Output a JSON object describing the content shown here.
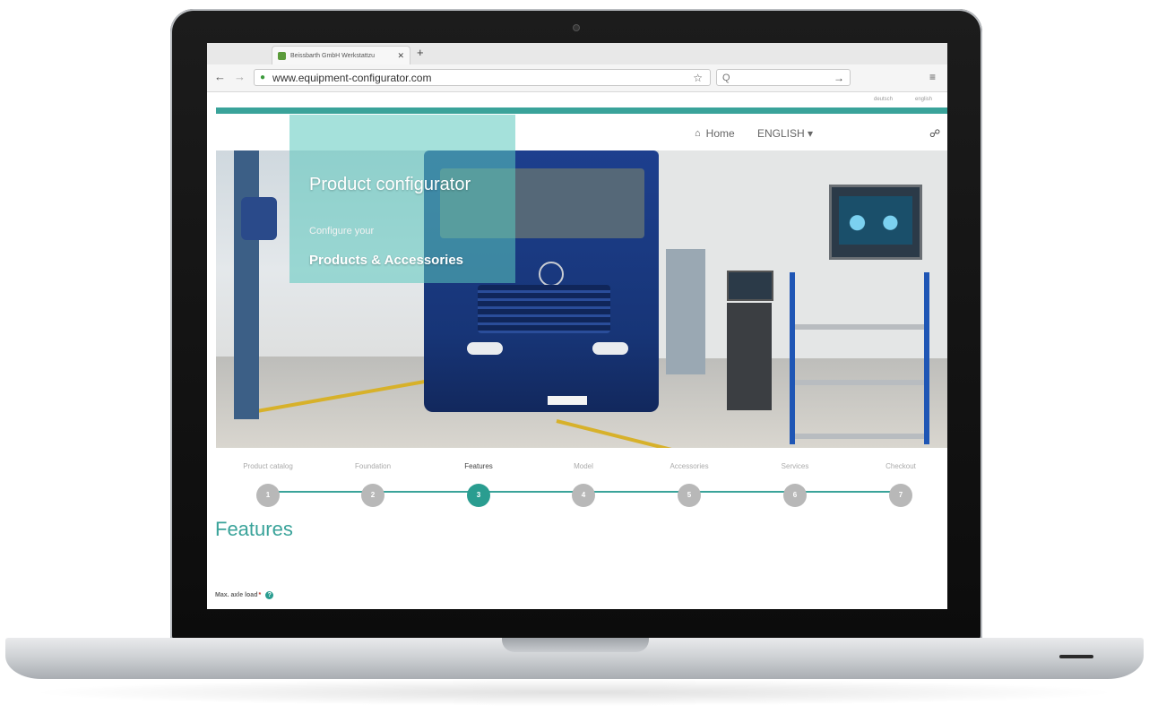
{
  "browser": {
    "tab_title": "Beissbarth GmbH Werkstattzu",
    "tab_close": "✕",
    "new_tab": "+",
    "back": "←",
    "forward": "→",
    "url": "www.equipment-configurator.com",
    "search_placeholder": "Q",
    "search_go": "→",
    "menu": "≡",
    "bookmark": "☆",
    "lock": "🔒"
  },
  "header": {
    "lang_links": [
      "deutsch",
      "english"
    ],
    "home_label": "Home",
    "language_label": "ENGLISH ▾",
    "cart_icon": "🛒"
  },
  "hero": {
    "title": "Product configurator",
    "subtitle1": "Configure your",
    "subtitle2": "Products & Accessories"
  },
  "stepper": {
    "active_step": 3,
    "steps": [
      {
        "label": "Product catalog",
        "number": "1"
      },
      {
        "label": "Foundation",
        "number": "2"
      },
      {
        "label": "Features",
        "number": "3"
      },
      {
        "label": "Model",
        "number": "4"
      },
      {
        "label": "Accessories",
        "number": "5"
      },
      {
        "label": "Services",
        "number": "6"
      },
      {
        "label": "Checkout",
        "number": "7"
      }
    ]
  },
  "main": {
    "section_title": "Features",
    "field_label": "Max. axle load",
    "required_mark": "*",
    "help_icon": "?"
  },
  "colors": {
    "accent": "#3aa39a",
    "active_step": "#2a9d90",
    "inactive_step": "#b8b8b8",
    "truck_blue": "#1d3f8e"
  }
}
